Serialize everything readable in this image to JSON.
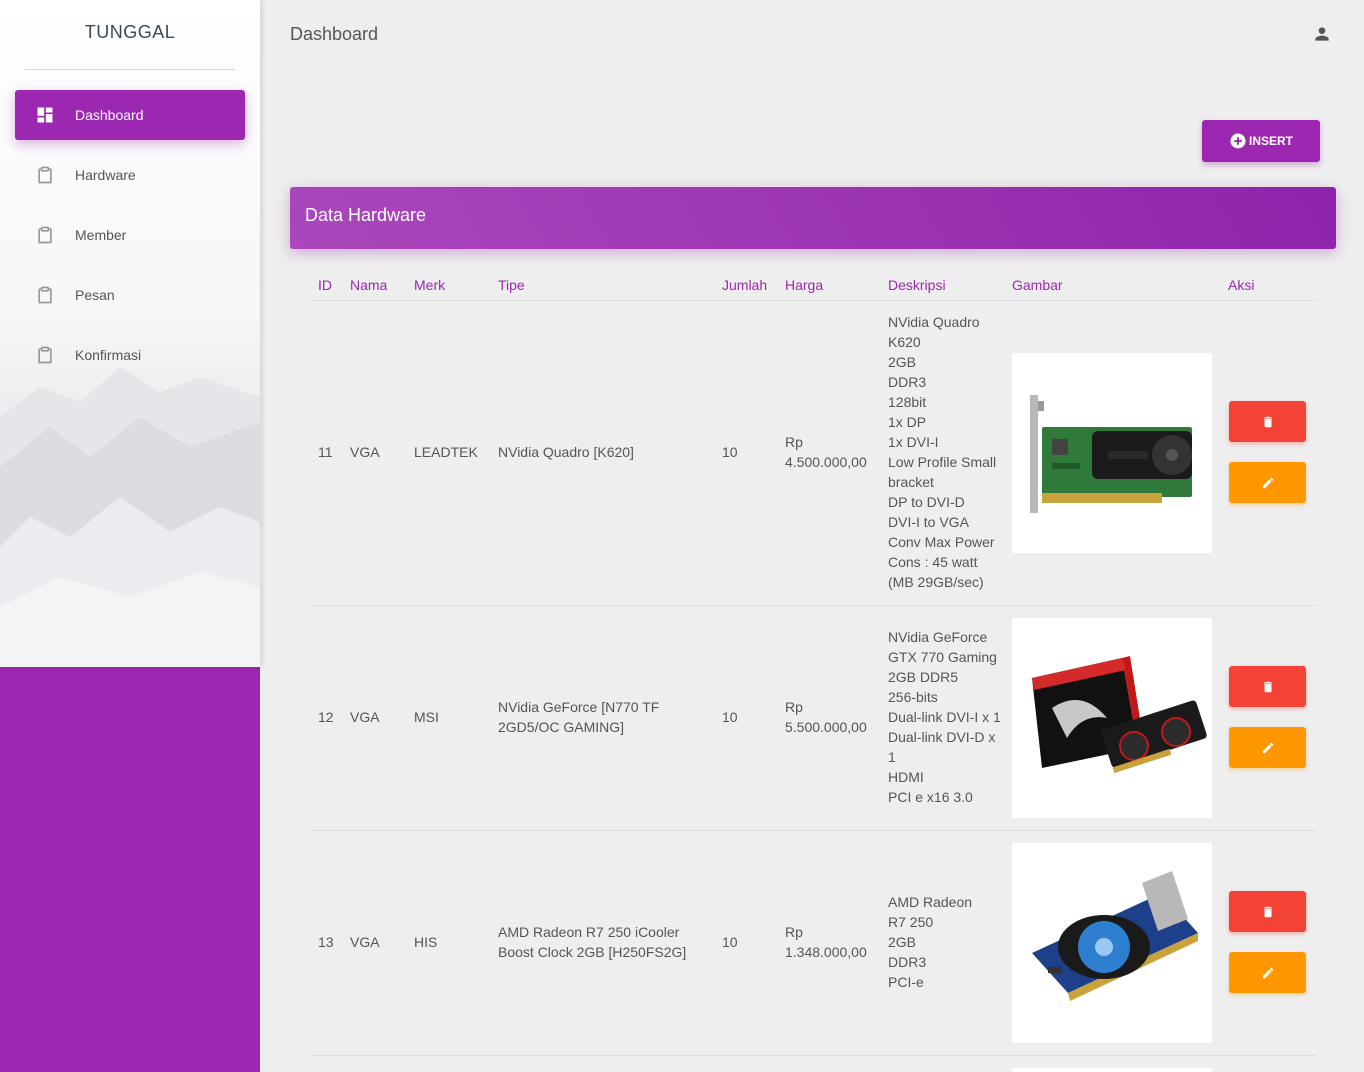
{
  "sidebar": {
    "brand": "TUNGGAL",
    "items": [
      {
        "label": "Dashboard",
        "icon": "dashboard-icon",
        "active": true
      },
      {
        "label": "Hardware",
        "icon": "clipboard-icon",
        "active": false
      },
      {
        "label": "Member",
        "icon": "clipboard-icon",
        "active": false
      },
      {
        "label": "Pesan",
        "icon": "clipboard-icon",
        "active": false
      },
      {
        "label": "Konfirmasi",
        "icon": "clipboard-icon",
        "active": false
      }
    ]
  },
  "header": {
    "title": "Dashboard",
    "user_icon": "person-icon"
  },
  "toolbar": {
    "insert_label": "INSERT"
  },
  "card": {
    "title": "Data Hardware"
  },
  "colors": {
    "accent": "#9c27b0",
    "danger": "#f44336",
    "warning": "#ff9800"
  },
  "table": {
    "columns": [
      "ID",
      "Nama",
      "Merk",
      "Tipe",
      "Jumlah",
      "Harga",
      "Deskripsi",
      "Gambar",
      "Aksi"
    ],
    "rows": [
      {
        "id": "11",
        "nama": "VGA",
        "merk": "LEADTEK",
        "tipe": [
          "NVidia Quadro [K620]"
        ],
        "jumlah": "10",
        "harga": [
          "Rp",
          "4.500.000,00"
        ],
        "deskripsi": [
          "NVidia Quadro",
          "K620",
          "2GB",
          "DDR3",
          "128bit",
          "1x DP",
          "1x DVI-I",
          "Low Profile Small",
          "bracket",
          "DP to DVI-D",
          "DVI-I to VGA",
          "Conv Max Power",
          "Cons : 45 watt",
          "(MB 29GB/sec)"
        ],
        "gambar": "quadro-card-image"
      },
      {
        "id": "12",
        "nama": "VGA",
        "merk": "MSI",
        "tipe": [
          "NVidia GeForce [N770 TF",
          "2GD5/OC GAMING]"
        ],
        "jumlah": "10",
        "harga": [
          "Rp",
          "5.500.000,00"
        ],
        "deskripsi": [
          "NVidia GeForce",
          "GTX 770 Gaming",
          "2GB DDR5",
          "256-bits",
          "Dual-link DVI-I x 1",
          "Dual-link DVI-D x",
          "1",
          "HDMI",
          "PCI e x16 3.0"
        ],
        "gambar": "msi-gaming-card-image"
      },
      {
        "id": "13",
        "nama": "VGA",
        "merk": "HIS",
        "tipe": [
          "AMD Radeon R7 250 iCooler",
          "Boost Clock 2GB [H250FS2G]"
        ],
        "jumlah": "10",
        "harga": [
          "Rp",
          "1.348.000,00"
        ],
        "deskripsi": [
          "AMD Radeon",
          "R7 250",
          "2GB",
          "DDR3",
          "PCI-e"
        ],
        "gambar": "his-radeon-card-image"
      }
    ]
  }
}
